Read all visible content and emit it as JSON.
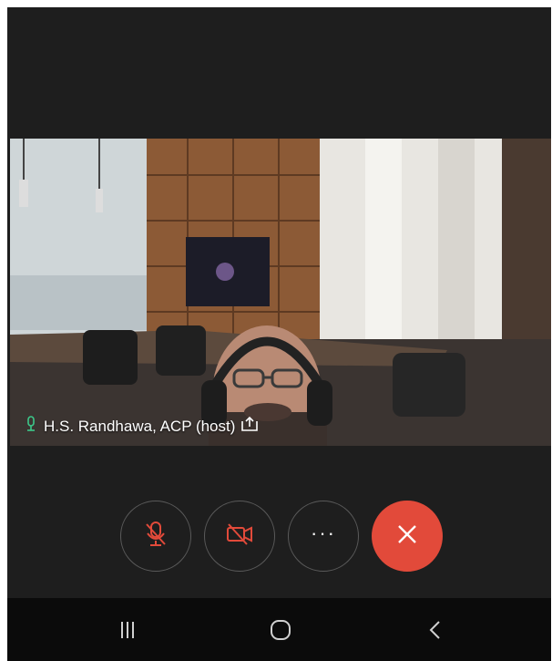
{
  "call": {
    "participant_name": "H.S. Randhawa, ACP (host)",
    "participant_status_icons": [
      "mic-icon",
      "share-icon"
    ]
  },
  "controls": [
    {
      "name": "mute-button",
      "icon": "mic-off-icon",
      "color": "#e24a3a"
    },
    {
      "name": "video-button",
      "icon": "video-off-icon",
      "color": "#e24a3a"
    },
    {
      "name": "more-button",
      "icon": "more-icon",
      "label": "···"
    },
    {
      "name": "end-call-button",
      "icon": "close-icon",
      "color": "#e24a3a"
    }
  ],
  "navbar": {
    "buttons": [
      "recents-icon",
      "home-icon",
      "back-icon"
    ]
  },
  "colors": {
    "background": "#1e1e1e",
    "accent_red": "#e24a3a",
    "mic_green": "#3cc88a"
  }
}
